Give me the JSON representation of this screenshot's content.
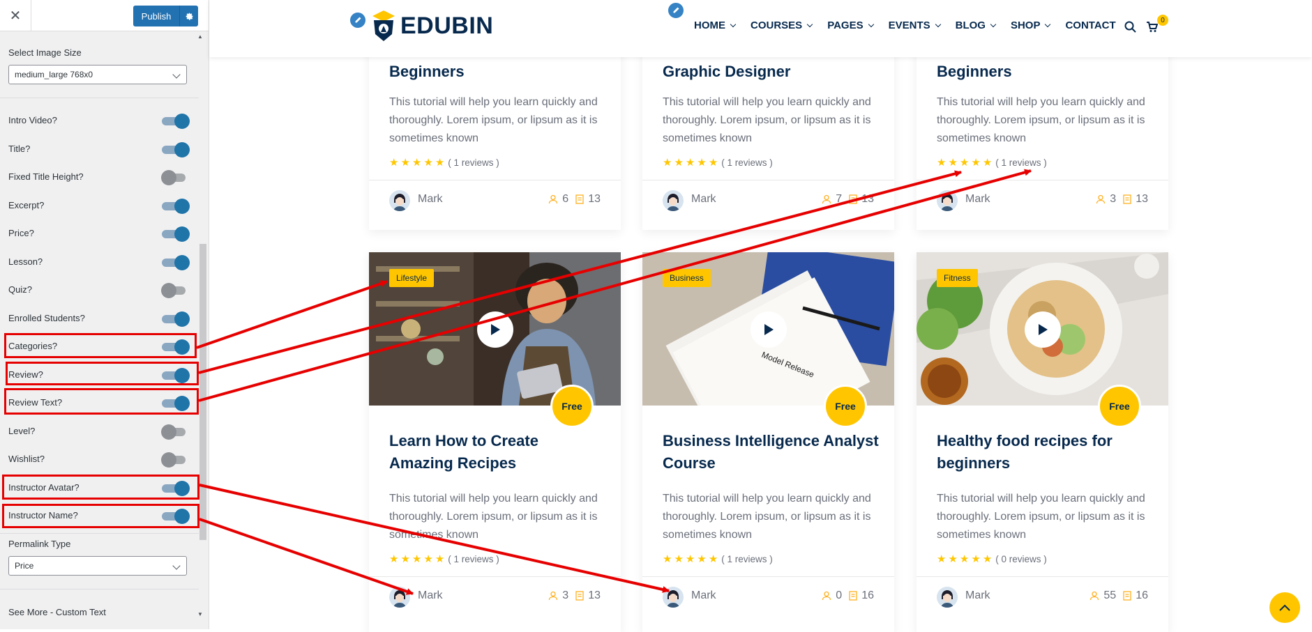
{
  "sidebar": {
    "publish_label": "Publish",
    "image_size_label": "Select Image Size",
    "image_size_value": "medium_large 768x0",
    "toggles": [
      {
        "label": "Intro Video?",
        "on": true
      },
      {
        "label": "Title?",
        "on": true
      },
      {
        "label": "Fixed Title Height?",
        "on": false
      },
      {
        "label": "Excerpt?",
        "on": true
      },
      {
        "label": "Price?",
        "on": true
      },
      {
        "label": "Lesson?",
        "on": true
      },
      {
        "label": "Quiz?",
        "on": false
      },
      {
        "label": "Enrolled Students?",
        "on": true
      },
      {
        "label": "Categories?",
        "on": true
      },
      {
        "label": "Review?",
        "on": true
      },
      {
        "label": "Review Text?",
        "on": true
      },
      {
        "label": "Level?",
        "on": false
      },
      {
        "label": "Wishlist?",
        "on": false
      },
      {
        "label": "Instructor Avatar?",
        "on": true
      },
      {
        "label": "Instructor Name?",
        "on": true
      }
    ],
    "permalink_label": "Permalink Type",
    "permalink_value": "Price",
    "see_more_label": "See More - Custom Text"
  },
  "header": {
    "logo_text": "EDUBIN",
    "nav": [
      {
        "label": "HOME",
        "dropdown": true
      },
      {
        "label": "COURSES",
        "dropdown": true
      },
      {
        "label": "PAGES",
        "dropdown": true
      },
      {
        "label": "EVENTS",
        "dropdown": true
      },
      {
        "label": "BLOG",
        "dropdown": true
      },
      {
        "label": "SHOP",
        "dropdown": true
      },
      {
        "label": "CONTACT",
        "dropdown": false
      }
    ],
    "cart_count": "0"
  },
  "top_cards": [
    {
      "title": "Beginners",
      "excerpt": "This tutorial will help you learn quickly and thoroughly. Lorem ipsum, or lipsum as it is sometimes known",
      "reviews": "( 1 reviews )",
      "instructor": "Mark",
      "students": "6",
      "lessons": "13"
    },
    {
      "title": "Graphic Designer",
      "excerpt": "This tutorial will help you learn quickly and thoroughly. Lorem ipsum, or lipsum as it is sometimes known",
      "reviews": "( 1 reviews )",
      "instructor": "Mark",
      "students": "7",
      "lessons": "13"
    },
    {
      "title": "Beginners",
      "excerpt": "This tutorial will help you learn quickly and thoroughly. Lorem ipsum, or lipsum as it is sometimes known",
      "reviews": "( 1 reviews )",
      "instructor": "Mark",
      "students": "3",
      "lessons": "13"
    }
  ],
  "courses": [
    {
      "category": "Lifestyle",
      "price": "Free",
      "title": "Learn How to Create Amazing Recipes",
      "excerpt": "This tutorial will help you learn quickly and thoroughly. Lorem ipsum, or lipsum as it is sometimes known",
      "reviews": "( 1 reviews )",
      "instructor": "Mark",
      "students": "3",
      "lessons": "13"
    },
    {
      "category": "Business",
      "price": "Free",
      "title": "Business Intelligence Analyst Course",
      "excerpt": "This tutorial will help you learn quickly and thoroughly. Lorem ipsum, or lipsum as it is sometimes known",
      "reviews": "( 1 reviews )",
      "instructor": "Mark",
      "students": "0",
      "lessons": "16"
    },
    {
      "category": "Fitness",
      "price": "Free",
      "title": "Healthy food recipes for beginners",
      "excerpt": "This tutorial will help you learn quickly and thoroughly. Lorem ipsum, or lipsum as it is sometimes known",
      "reviews": "( 0 reviews )",
      "instructor": "Mark",
      "students": "55",
      "lessons": "16"
    }
  ],
  "image_text": {
    "notebook_caption": "Model Release"
  },
  "colors": {
    "brand_navy": "#07294d",
    "accent_yellow": "#ffc600",
    "annotation_red": "#e60000",
    "wp_blue": "#2271b1"
  }
}
